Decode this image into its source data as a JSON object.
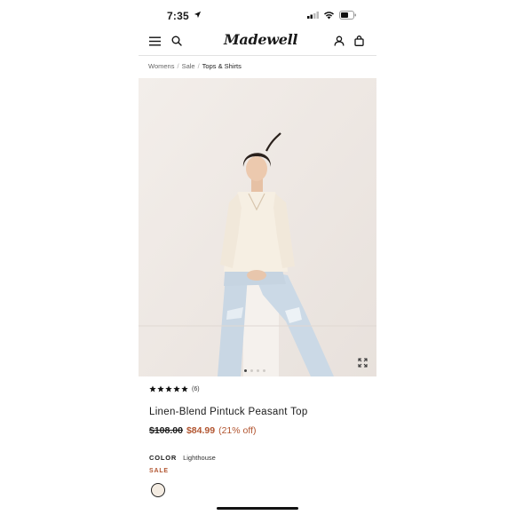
{
  "status_bar": {
    "time": "7:35"
  },
  "header": {
    "logo": "Madewell"
  },
  "breadcrumb": {
    "items": [
      "Womens",
      "Sale"
    ],
    "current": "Tops & Shirts"
  },
  "product": {
    "review_count": "(6)",
    "rating_stars": 5,
    "name": "Linen-Blend Pintuck Peasant Top",
    "original_price": "$108.00",
    "sale_price": "$84.99",
    "discount": "(21% off)",
    "color_label": "COLOR",
    "color_value": "Lighthouse",
    "sale_tag": "SALE",
    "image_count": 4,
    "active_image": 1
  },
  "colors": {
    "sale": "#b25530",
    "swatch": "#f4ece2"
  }
}
